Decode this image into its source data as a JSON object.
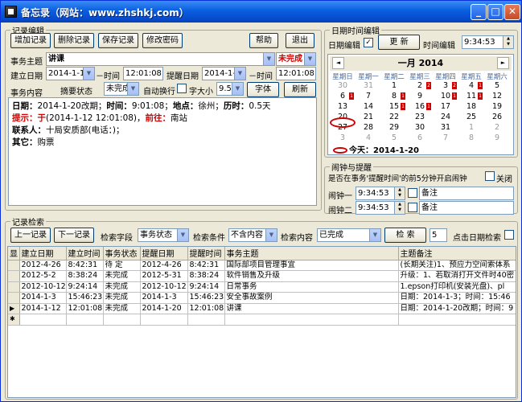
{
  "window": {
    "title": "备忘录（网站：www.zhshkj.com）",
    "min": "_",
    "max": "□",
    "close": "✕"
  },
  "edit_group": {
    "legend": "记录编辑",
    "buttons": {
      "add": "增加记录",
      "delete": "删除记录",
      "save": "保存记录",
      "password": "修改密码",
      "help": "帮助",
      "exit": "退出"
    },
    "subject_label": "事务主题",
    "subject_value": "讲课",
    "status_value": "未完成",
    "build_date_label": "建立日期",
    "build_date": "2014-1-12",
    "time_label1": "时间",
    "build_time": "12:01:08",
    "remind_date_label": "提醒日期",
    "remind_date": "2014-1-20",
    "time_label2": "时间",
    "remind_time": "12:01:08",
    "content_label": "事务内容",
    "abstract_label": "摘要状态",
    "abstract_value": "未完成",
    "autowrap_label": "自动换行",
    "fontsize_label": "字大小",
    "fontsize_value": "9.5",
    "font_button": "字体",
    "refresh_button": "刷新"
  },
  "memo": {
    "line1_a": "日期：",
    "line1_b": "2014-1-20改期；",
    "line1_c": "时间：",
    "line1_d": "9:01:08；",
    "line1_e": "地点：",
    "line1_f": "徐州；",
    "line1_g": "历时：",
    "line1_h": "0.5天",
    "line2_a": "提示：",
    "line2_b": "于",
    "line2_c": "(2014-1-12 12:01:08)，",
    "line2_d": "前往：",
    "line2_e": "南站",
    "line3_a": "联系人：",
    "line3_b": "十局安质部(电话：)；",
    "line4_a": "其它：",
    "line4_b": "购票"
  },
  "date_group": {
    "legend": "日期时间编辑",
    "date_edit_label": "日期编辑",
    "update_button": "更 新",
    "time_edit_label": "时间编辑",
    "time_value": "9:34:53"
  },
  "calendar": {
    "month_title": "一月 2014",
    "prev": "◄",
    "next": "►",
    "weekdays": [
      "星期日",
      "星期一",
      "星期二",
      "星期三",
      "星期四",
      "星期五",
      "星期六"
    ],
    "weeks": [
      [
        "30",
        "31",
        "1",
        "2",
        "3",
        "4",
        "5"
      ],
      [
        "6",
        "7",
        "8",
        "9",
        "10",
        "11",
        "12"
      ],
      [
        "13",
        "14",
        "15",
        "16",
        "17",
        "18",
        "19"
      ],
      [
        "20",
        "21",
        "22",
        "23",
        "24",
        "25",
        "26"
      ],
      [
        "27",
        "28",
        "29",
        "30",
        "31",
        "1",
        "2"
      ],
      [
        "3",
        "4",
        "5",
        "6",
        "7",
        "8",
        "9"
      ]
    ],
    "marks": [
      {
        "week": 0,
        "day": 3,
        "label": "2"
      },
      {
        "week": 0,
        "day": 4,
        "label": "2"
      },
      {
        "week": 0,
        "day": 5,
        "label": "1"
      },
      {
        "week": 1,
        "day": 0,
        "label": "1"
      },
      {
        "week": 1,
        "day": 2,
        "label": "1"
      },
      {
        "week": 1,
        "day": 4,
        "label": "1"
      },
      {
        "week": 1,
        "day": 5,
        "label": "1"
      },
      {
        "week": 2,
        "day": 2,
        "label": "1"
      },
      {
        "week": 2,
        "day": 3,
        "label": "1"
      }
    ],
    "today_label": "今天：",
    "today_value": "2014-1-20"
  },
  "alarm_group": {
    "legend": "闹钟与提醒",
    "question": "是否在事务'提醒时间'的前5分钟开启闹钟",
    "close_label": "关闭",
    "alarm1_label": "闹钟一",
    "alarm1_time": "9:34:53",
    "alarm1_note": "备注",
    "alarm2_label": "闹钟二",
    "alarm2_time": "9:34:53",
    "alarm2_note": "备注"
  },
  "search_group": {
    "legend": "记录检索",
    "prev_button": "上一记录",
    "next_button": "下一记录",
    "field_label": "检索字段",
    "field_value": "事务状态",
    "cond_label": "检索条件",
    "cond_value": "不含内容",
    "content_label": "检索内容",
    "content_value": "已完成",
    "search_button": "检 索",
    "count_value": "5",
    "date_search_label": "点击日期检索"
  },
  "table": {
    "headers": [
      "显",
      "建立日期",
      "建立时间",
      "事务状态",
      "提醒日期",
      "提醒时间",
      "事务主题",
      "主题备注"
    ],
    "rows": [
      [
        "",
        "2012-4-26",
        "8:42:31",
        "待 定",
        "2012-4-26",
        "8:42:31",
        "国际部项目管理事宜",
        "(长期关注)1、预应力空间索体系"
      ],
      [
        "",
        "2012-5-2",
        "8:38:24",
        "未完成",
        "2012-5-31",
        "8:38:24",
        "软件销售及升级",
        "升级：1、若取消打开文件时40密"
      ],
      [
        "",
        "2012-10-12",
        "9:24:14",
        "未完成",
        "2012-10-12",
        "9:24:14",
        "日常事务",
        "1.epson打印机(安装光盘)、pl"
      ],
      [
        "",
        "2014-1-3",
        "15:46:23",
        "未完成",
        "2014-1-3",
        "15:46:23",
        "安全事故案例",
        "日期：2014-1-3；时间：15:46"
      ],
      [
        "▶",
        "2014-1-12",
        "12:01:08",
        "未完成",
        "2014-1-20",
        "12:01:08",
        "讲课",
        "日期：2014-1-20改期；时间：9"
      ],
      [
        "✱",
        "",
        "",
        "",
        "",
        "",
        "",
        ""
      ]
    ]
  }
}
